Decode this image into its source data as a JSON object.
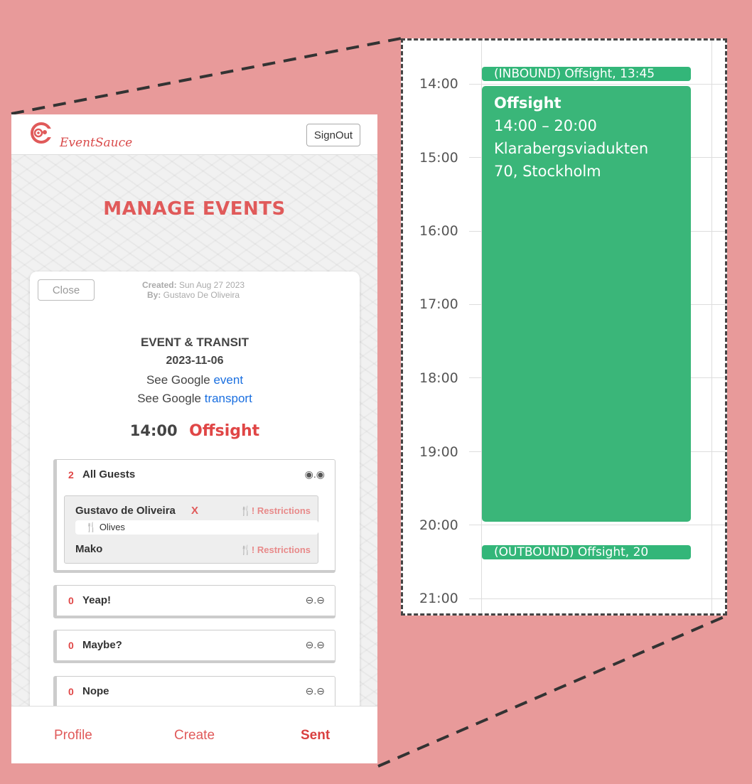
{
  "app": {
    "brand": "EventSauce",
    "signout_label": "SignOut",
    "page_title": "MANAGE EVENTS",
    "accent_color": "#e05a5a",
    "link_color": "#1a6fe0"
  },
  "card": {
    "close_label": "Close",
    "created_label": "Created:",
    "created_value": "Sun Aug 27 2023",
    "by_label": "By:",
    "by_value": "Gustavo De Oliveira",
    "heading": "EVENT & TRANSIT",
    "date": "2023-11-06",
    "see_google_prefix": "See Google",
    "event_link": "event",
    "transport_link": "transport",
    "event_time": "14:00",
    "event_name": "Offsight"
  },
  "groups": [
    {
      "count": "2",
      "label": "All Guests",
      "toggle": "◉.◉"
    },
    {
      "count": "0",
      "label": "Yeap!",
      "toggle": "⊖.⊖"
    },
    {
      "count": "0",
      "label": "Maybe?",
      "toggle": "⊖.⊖"
    },
    {
      "count": "0",
      "label": "Nope",
      "toggle": "⊖.⊖"
    }
  ],
  "guests": [
    {
      "name": "Gustavo de Oliveira",
      "remove": "X",
      "restrictions": "! Restrictions",
      "restriction_item": "Olives",
      "restriction_icon": "fork-knife-icon"
    },
    {
      "name": "Mako",
      "restrictions": "! Restrictions",
      "restriction_icon": "fork-knife-icon"
    }
  ],
  "footer": {
    "profile": "Profile",
    "create": "Create",
    "sent": "Sent"
  },
  "calendar": {
    "event_color": "#33b679",
    "times": [
      "14:00",
      "15:00",
      "16:00",
      "17:00",
      "18:00",
      "19:00",
      "20:00",
      "21:00"
    ],
    "inbound": "(INBOUND) Offsight, 13:45",
    "outbound": "(OUTBOUND) Offsight, 20",
    "event_title": "Offsight",
    "event_range": "14:00 – 20:00",
    "event_address_1": "Klarabergsviadukten",
    "event_address_2": "70, Stockholm"
  }
}
